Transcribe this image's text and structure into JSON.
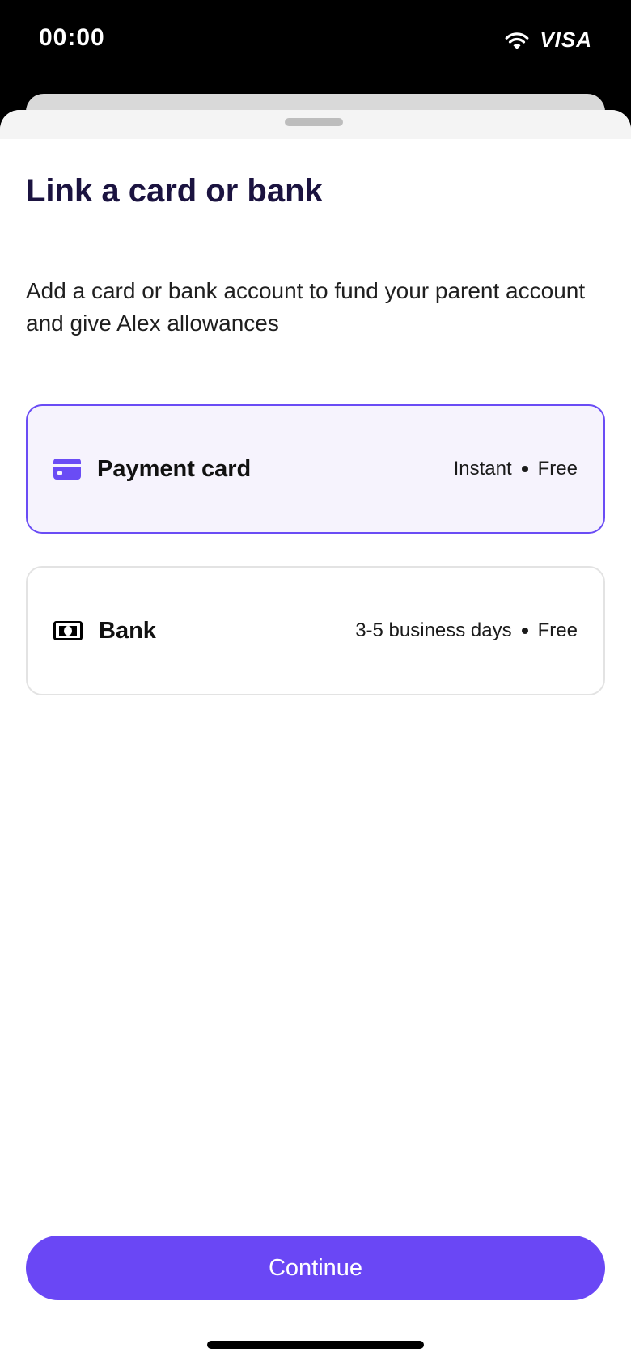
{
  "status_bar": {
    "time": "00:00",
    "carrier": "VISA",
    "wifi_icon": "wifi-icon"
  },
  "sheet": {
    "title": "Link a card or bank",
    "description": "Add a card or bank account to fund your parent account and give Alex allowances"
  },
  "options": [
    {
      "icon": "credit-card-icon",
      "label": "Payment card",
      "speed": "Instant",
      "fee": "Free",
      "selected": true
    },
    {
      "icon": "banknote-icon",
      "label": "Bank",
      "speed": "3-5 business days",
      "fee": "Free",
      "selected": false
    }
  ],
  "footer": {
    "continue_label": "Continue"
  },
  "colors": {
    "accent": "#6a47f5",
    "selected_bg": "#f6f3fd",
    "title": "#1b1340"
  }
}
